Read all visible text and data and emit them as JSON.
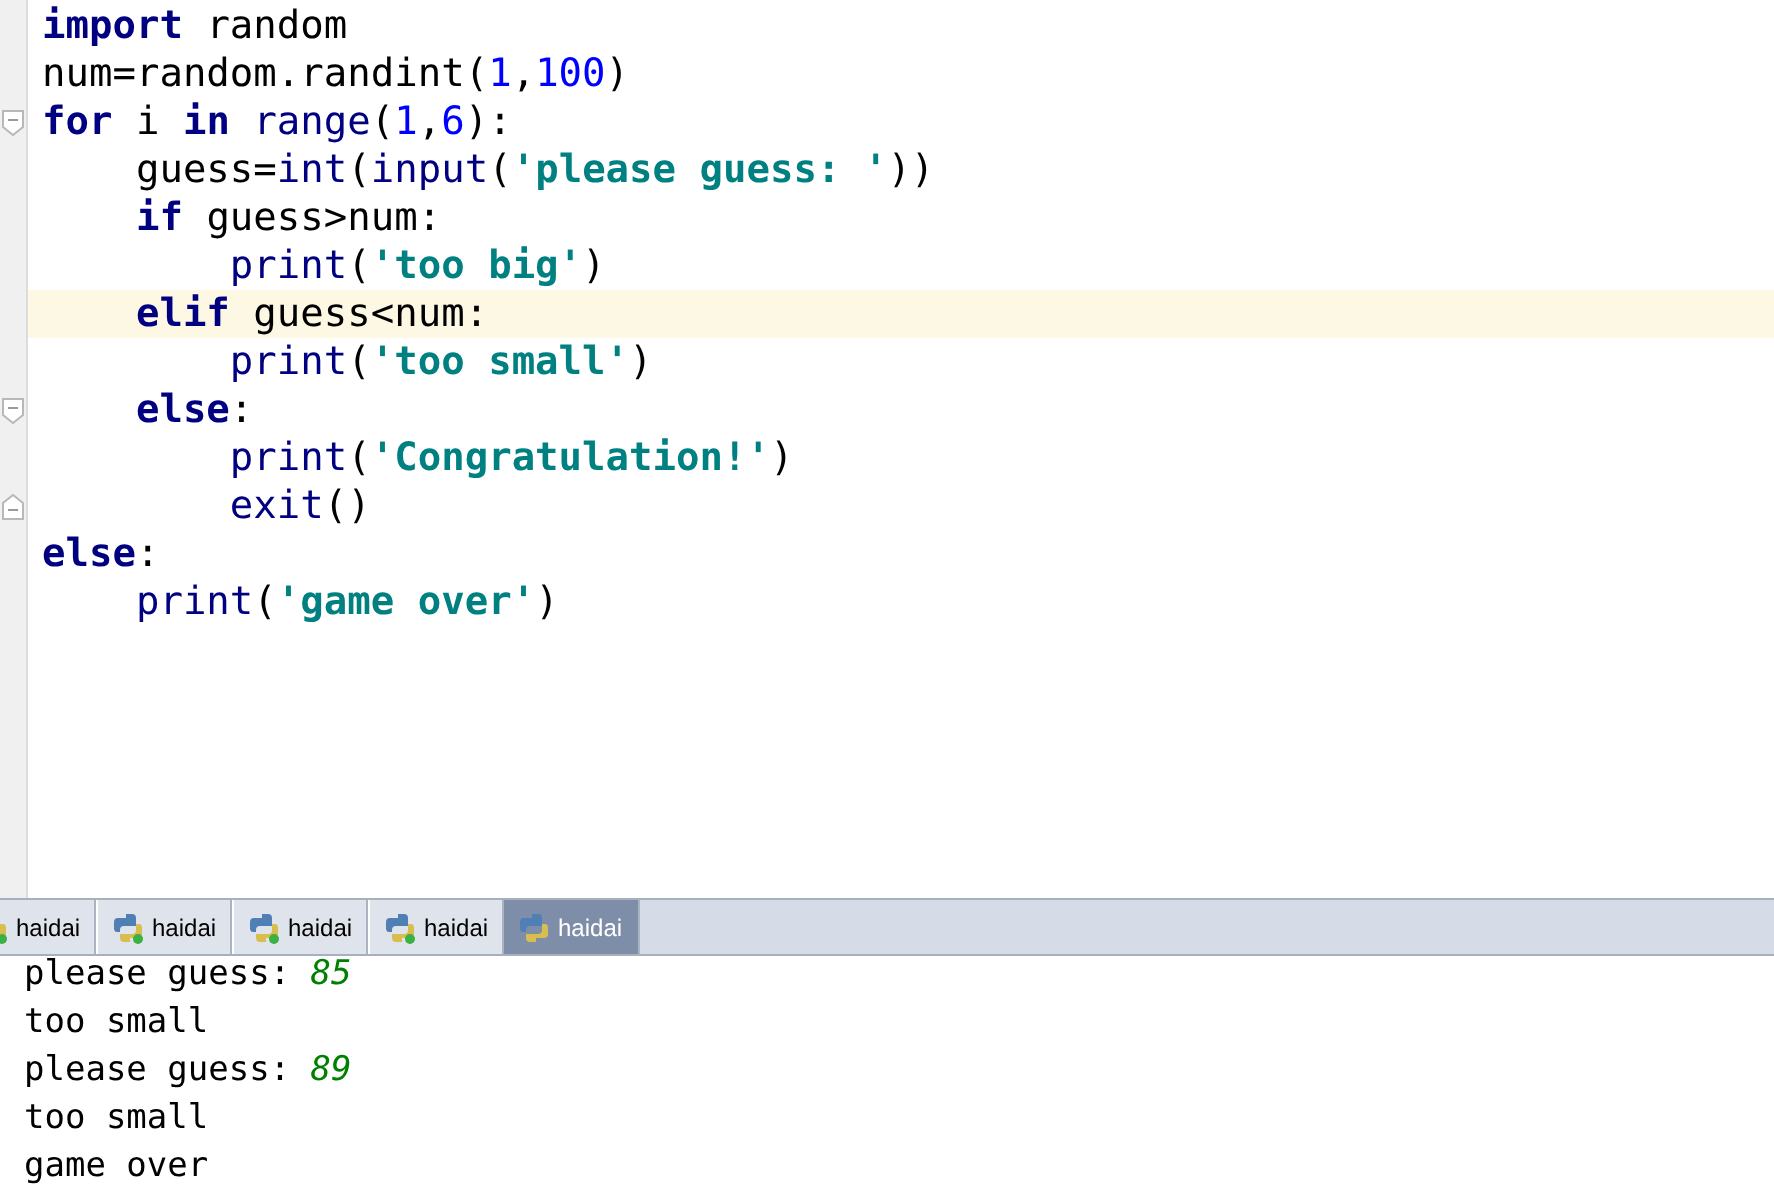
{
  "editor": {
    "lines": [
      {
        "current": false,
        "tokens": [
          {
            "kind": "kw",
            "text": "import"
          },
          {
            "kind": "plain",
            "text": " random"
          }
        ]
      },
      {
        "current": false,
        "tokens": [
          {
            "kind": "plain",
            "text": "num=random.randint("
          },
          {
            "kind": "num",
            "text": "1"
          },
          {
            "kind": "plain",
            "text": ","
          },
          {
            "kind": "num",
            "text": "100"
          },
          {
            "kind": "plain",
            "text": ")"
          }
        ]
      },
      {
        "current": false,
        "fold_start": true,
        "tokens": [
          {
            "kind": "kw",
            "text": "for"
          },
          {
            "kind": "plain",
            "text": " i "
          },
          {
            "kind": "kw",
            "text": "in"
          },
          {
            "kind": "builtin",
            "text": " range"
          },
          {
            "kind": "plain",
            "text": "("
          },
          {
            "kind": "num",
            "text": "1"
          },
          {
            "kind": "plain",
            "text": ","
          },
          {
            "kind": "num",
            "text": "6"
          },
          {
            "kind": "plain",
            "text": "):"
          }
        ]
      },
      {
        "current": false,
        "tokens": [
          {
            "kind": "plain",
            "text": "    guess="
          },
          {
            "kind": "builtin",
            "text": "int"
          },
          {
            "kind": "plain",
            "text": "("
          },
          {
            "kind": "builtin",
            "text": "input"
          },
          {
            "kind": "plain",
            "text": "("
          },
          {
            "kind": "str",
            "text": "'please guess: '"
          },
          {
            "kind": "plain",
            "text": "))"
          }
        ]
      },
      {
        "current": false,
        "tokens": [
          {
            "kind": "kw",
            "text": "    if"
          },
          {
            "kind": "plain",
            "text": " guess>num:"
          }
        ]
      },
      {
        "current": false,
        "tokens": [
          {
            "kind": "builtin",
            "text": "        print"
          },
          {
            "kind": "plain",
            "text": "("
          },
          {
            "kind": "str",
            "text": "'too big'"
          },
          {
            "kind": "plain",
            "text": ")"
          }
        ]
      },
      {
        "current": true,
        "tokens": [
          {
            "kind": "kw",
            "text": "    elif"
          },
          {
            "kind": "plain",
            "text": " guess<num:"
          }
        ]
      },
      {
        "current": false,
        "tokens": [
          {
            "kind": "builtin",
            "text": "        print"
          },
          {
            "kind": "plain",
            "text": "("
          },
          {
            "kind": "str",
            "text": "'too small'"
          },
          {
            "kind": "plain",
            "text": ")"
          }
        ]
      },
      {
        "current": false,
        "fold_start": true,
        "tokens": [
          {
            "kind": "kw",
            "text": "    else"
          },
          {
            "kind": "plain",
            "text": ":"
          }
        ]
      },
      {
        "current": false,
        "tokens": [
          {
            "kind": "builtin",
            "text": "        print"
          },
          {
            "kind": "plain",
            "text": "("
          },
          {
            "kind": "str",
            "text": "'Congratulation!'"
          },
          {
            "kind": "plain",
            "text": ")"
          }
        ]
      },
      {
        "current": false,
        "fold_end": true,
        "tokens": [
          {
            "kind": "builtin",
            "text": "        exit"
          },
          {
            "kind": "plain",
            "text": "()"
          }
        ]
      },
      {
        "current": false,
        "tokens": [
          {
            "kind": "kw",
            "text": "else"
          },
          {
            "kind": "plain",
            "text": ":"
          }
        ]
      },
      {
        "current": false,
        "tokens": [
          {
            "kind": "builtin",
            "text": "    print"
          },
          {
            "kind": "plain",
            "text": "("
          },
          {
            "kind": "str",
            "text": "'game over'"
          },
          {
            "kind": "plain",
            "text": ")"
          }
        ]
      }
    ]
  },
  "run_tabs": [
    {
      "label": "haidai",
      "selected": false
    },
    {
      "label": "haidai",
      "selected": false
    },
    {
      "label": "haidai",
      "selected": false
    },
    {
      "label": "haidai",
      "selected": false
    },
    {
      "label": "haidai",
      "selected": true
    }
  ],
  "console": {
    "lines": [
      {
        "text": "please guess: ",
        "input": "85"
      },
      {
        "text": "too small"
      },
      {
        "text": "please guess: ",
        "input": "89"
      },
      {
        "text": "too small"
      },
      {
        "text": "game over"
      }
    ]
  }
}
